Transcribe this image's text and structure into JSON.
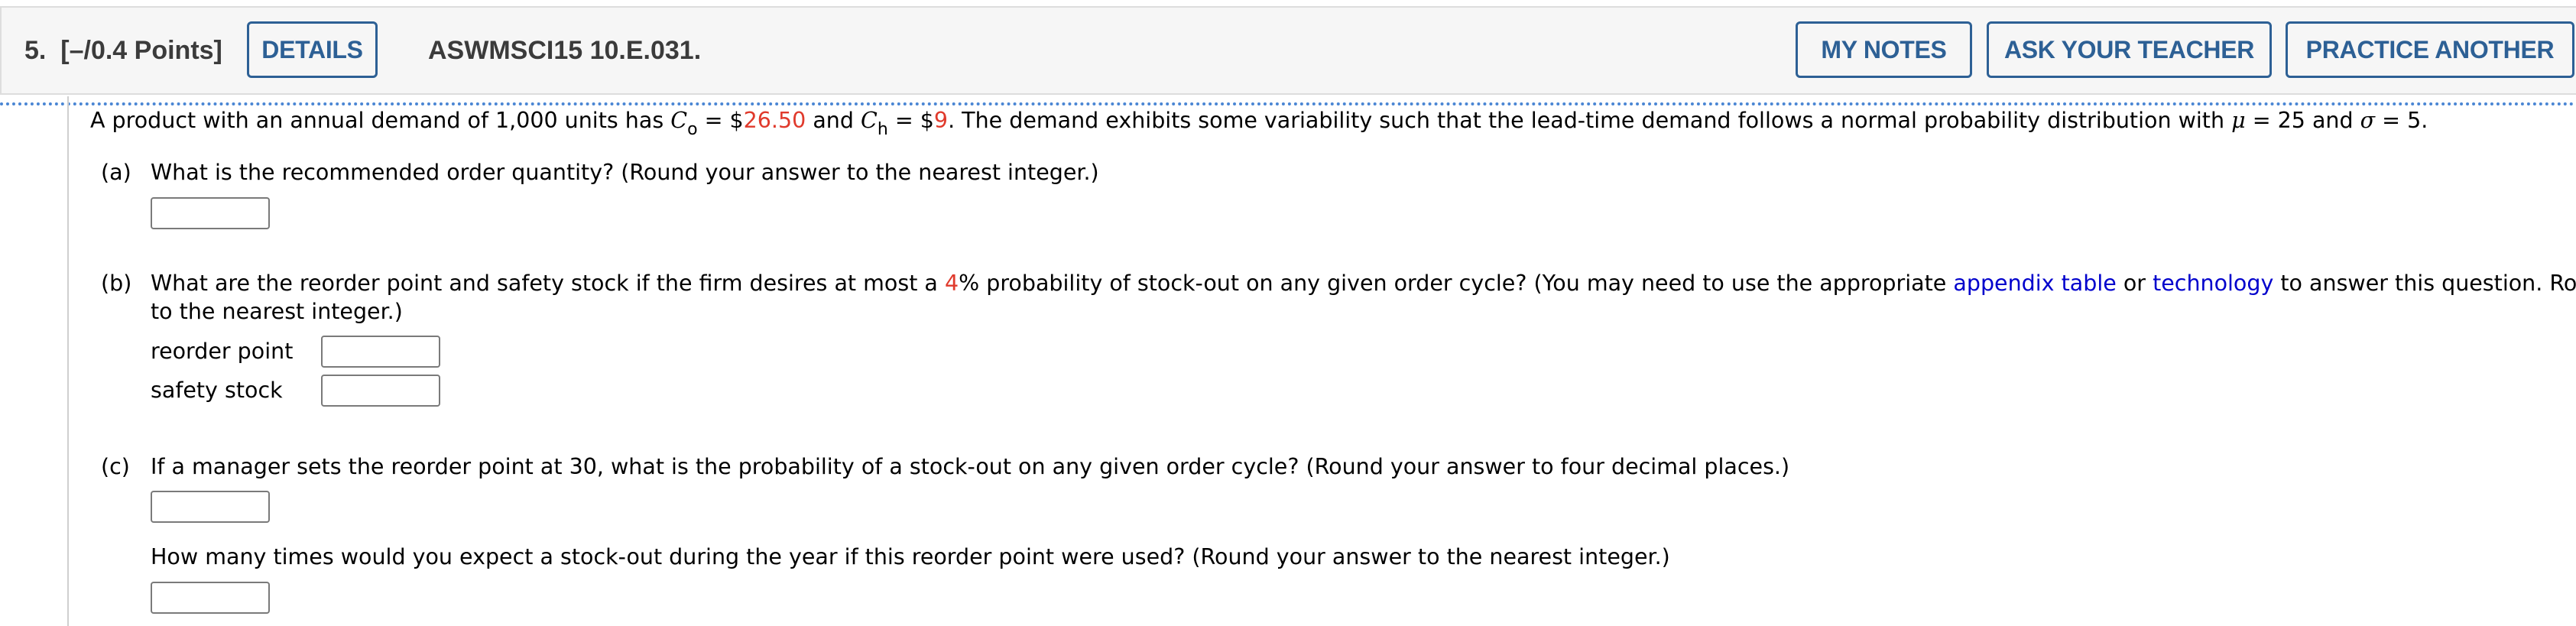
{
  "header": {
    "question_number": "5.",
    "points": "[–/0.4 Points]",
    "details_label": "DETAILS",
    "problem_id": "ASWMSCI15 10.E.031.",
    "my_notes_label": "MY NOTES",
    "ask_teacher_label": "ASK YOUR TEACHER",
    "practice_another_label": "PRACTICE ANOTHER"
  },
  "colors": {
    "accent_blue": "#2d6095",
    "variable_red": "#e03a2c",
    "link_blue": "#0000cc",
    "header_bg": "#f6f6f6"
  },
  "intro": {
    "part1": "A product with an annual demand of 1,000 units has ",
    "c_symbol": "C",
    "co_sub": "o",
    "eq1": " = $",
    "co_value": "26.50",
    "and1": " and ",
    "ch_sub": "h",
    "eq2": " = $",
    "ch_value": "9",
    "part2": ". The demand exhibits some variability such that the lead-time demand follows a normal probability distribution with ",
    "mu_symbol": "μ",
    "mu_eq": " = 25 and ",
    "sigma_symbol": "σ",
    "sigma_eq": " = 5."
  },
  "part_a": {
    "label": "(a)",
    "question": "What is the recommended order quantity? (Round your answer to the nearest integer.)",
    "answer_value": ""
  },
  "part_b": {
    "label": "(b)",
    "q_start": "What are the reorder point and safety stock if the firm desires at most a ",
    "stockout_pct": "4",
    "q_mid": "% probability of stock-out on any given order cycle? (You may need to use the appropriate ",
    "link_appendix": "appendix table",
    "q_or": " or ",
    "link_technology": "technology",
    "q_end": " to answer this question. Round your answers",
    "q_line2": "to the nearest integer.)",
    "fields": [
      {
        "label": "reorder point",
        "value": ""
      },
      {
        "label": "safety stock",
        "value": ""
      }
    ]
  },
  "part_c": {
    "label": "(c)",
    "question": "If a manager sets the reorder point at 30, what is the probability of a stock-out on any given order cycle? (Round your answer to four decimal places.)",
    "answer_value": "",
    "followup": "How many times would you expect a stock-out during the year if this reorder point were used? (Round your answer to the nearest integer.)",
    "followup_value": ""
  }
}
